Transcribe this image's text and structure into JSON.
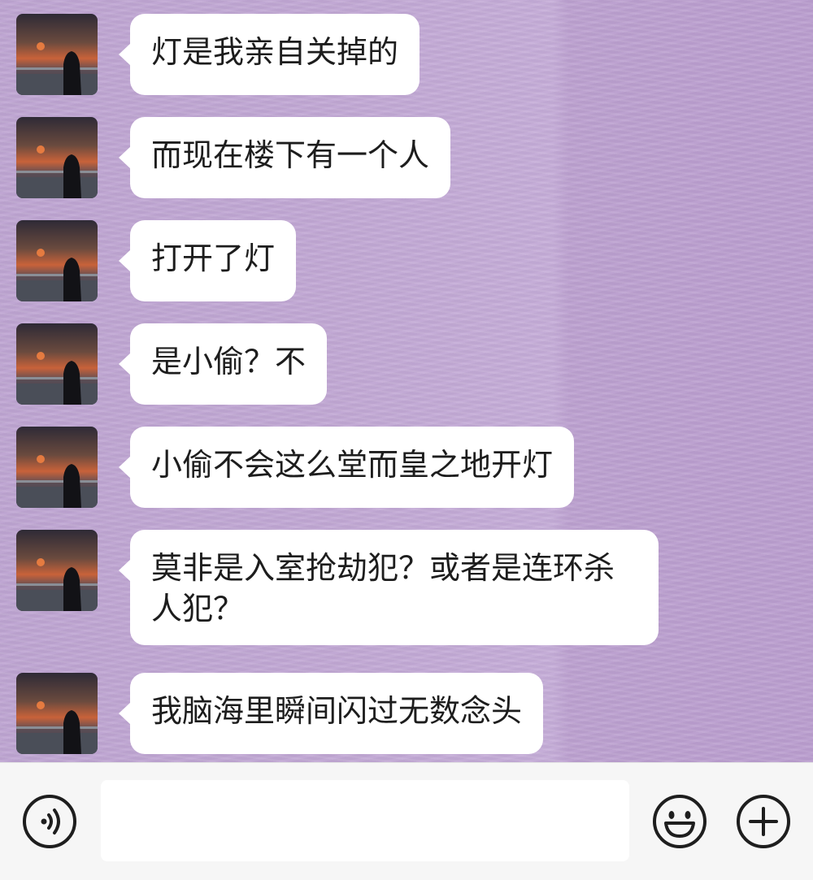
{
  "messages": [
    {
      "text": "灯是我亲自关掉的"
    },
    {
      "text": "而现在楼下有一个人"
    },
    {
      "text": "打开了灯"
    },
    {
      "text": "是小偷？不"
    },
    {
      "text": "小偷不会这么堂而皇之地开灯"
    },
    {
      "text": "莫非是入室抢劫犯？或者是连环杀人犯？"
    },
    {
      "text": "我脑海里瞬间闪过无数念头"
    }
  ],
  "input": {
    "value": "",
    "placeholder": ""
  },
  "icons": {
    "voice": "voice-icon",
    "emoji": "smile-icon",
    "more": "plus-icon"
  },
  "colors": {
    "chat_background": "#c2a9d4",
    "bubble": "#ffffff",
    "input_bar": "#f6f6f6"
  }
}
